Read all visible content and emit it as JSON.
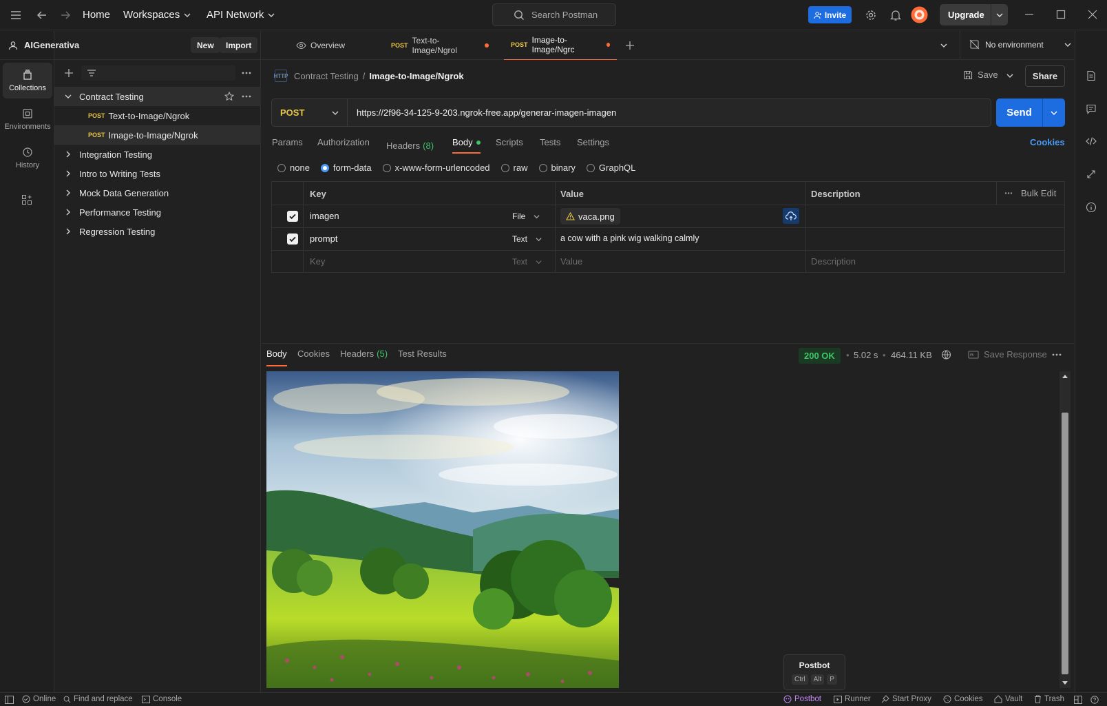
{
  "topbar": {
    "home": "Home",
    "workspaces": "Workspaces",
    "api_network": "API Network",
    "search_placeholder": "Search Postman",
    "invite": "Invite",
    "upgrade": "Upgrade"
  },
  "rail": {
    "items": [
      {
        "label": "Collections",
        "icon": "collections-icon"
      },
      {
        "label": "Environments",
        "icon": "environments-icon"
      },
      {
        "label": "History",
        "icon": "history-icon"
      }
    ]
  },
  "workspace": {
    "name": "AIGenerativa",
    "new_label": "New",
    "import_label": "Import"
  },
  "collections": [
    {
      "name": "Contract Testing",
      "expanded": true,
      "requests": [
        {
          "method": "POST",
          "name": "Text-to-Image/Ngrok"
        },
        {
          "method": "POST",
          "name": "Image-to-Image/Ngrok"
        }
      ]
    },
    {
      "name": "Integration Testing"
    },
    {
      "name": "Intro to Writing Tests"
    },
    {
      "name": "Mock Data Generation"
    },
    {
      "name": "Performance Testing"
    },
    {
      "name": "Regression Testing"
    }
  ],
  "tabs": [
    {
      "label": "Overview"
    },
    {
      "method": "POST",
      "label": "Text-to-Image/Ngrol"
    },
    {
      "method": "POST",
      "label": "Image-to-Image/Ngrc"
    }
  ],
  "environment": "No environment",
  "breadcrumb": {
    "collection": "Contract Testing",
    "separator": "/",
    "request": "Image-to-Image/Ngrok"
  },
  "request": {
    "save": "Save",
    "share": "Share",
    "method": "POST",
    "url": "https://2f96-34-125-9-203.ngrok-free.app/generar-imagen-imagen",
    "send": "Send",
    "tabs": {
      "params": "Params",
      "authorization": "Authorization",
      "headers": "Headers",
      "headers_count": "(8)",
      "body": "Body",
      "scripts": "Scripts",
      "tests": "Tests",
      "settings": "Settings",
      "cookies": "Cookies"
    },
    "body_modes": [
      "none",
      "form-data",
      "x-www-form-urlencoded",
      "raw",
      "binary",
      "GraphQL"
    ],
    "selected_mode": "form-data",
    "table": {
      "headers": {
        "key": "Key",
        "value": "Value",
        "description": "Description",
        "bulk_edit": "Bulk Edit"
      },
      "rows": [
        {
          "key": "imagen",
          "type": "File",
          "value": "vaca.png",
          "checked": true
        },
        {
          "key": "prompt",
          "type": "Text",
          "value": "a cow with a pink wig walking calmly",
          "checked": true
        }
      ],
      "placeholder": {
        "key": "Key",
        "type": "Text",
        "value": "Value",
        "description": "Description"
      }
    }
  },
  "response": {
    "tabs": {
      "body": "Body",
      "cookies": "Cookies",
      "headers": "Headers",
      "headers_count": "(5)",
      "test_results": "Test Results"
    },
    "status": "200 OK",
    "time": "5.02 s",
    "size": "464.11 KB",
    "save_response": "Save Response"
  },
  "postbot": {
    "label": "Postbot",
    "keys": [
      "Ctrl",
      "Alt",
      "P"
    ]
  },
  "statusbar": {
    "online": "Online",
    "find_replace": "Find and replace",
    "console": "Console",
    "postbot": "Postbot",
    "runner": "Runner",
    "start_proxy": "Start Proxy",
    "cookies": "Cookies",
    "vault": "Vault",
    "trash": "Trash"
  },
  "colors": {
    "accent": "#ff6c37",
    "primary": "#1d6ce0",
    "post": "#e8c547",
    "ok": "#3fc46a"
  }
}
